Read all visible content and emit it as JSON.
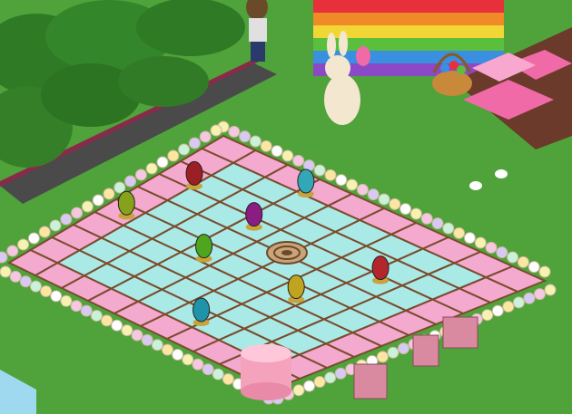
{
  "scene": {
    "type": "isometric-pixel-room",
    "theme": "easter-garden",
    "floor": {
      "rows": 10,
      "cols": 10,
      "tile_colors": [
        "#a9e9e6",
        "#f4a9cf"
      ],
      "grid_color": "#7a4b2c"
    },
    "eggs": [
      {
        "color": "#33a7b6",
        "label": "teal-egg"
      },
      {
        "color": "#9b1f25",
        "label": "red-egg"
      },
      {
        "color": "#8b1d82",
        "label": "purple-egg"
      },
      {
        "color": "#86a11a",
        "label": "green-egg"
      },
      {
        "color": "#4ea61e",
        "label": "lime-egg"
      },
      {
        "color": "#c0a31f",
        "label": "yellow-egg"
      },
      {
        "color": "#b3262b",
        "label": "red-egg-2"
      },
      {
        "color": "#1f93a7",
        "label": "blue-egg"
      }
    ],
    "colors": {
      "grass": "#4fa33a",
      "grass_dark": "#3e8a2d",
      "path": "#4a4a4a",
      "rainbow": [
        "#e8303a",
        "#f08a26",
        "#f2d636",
        "#5bbf3d",
        "#3a8fe0",
        "#8b48c7"
      ],
      "cake": "#f5a3bd",
      "rug": "#c9a47a",
      "bunny": "#f3e7cf"
    },
    "objects": [
      "bunny-statue",
      "egg-basket",
      "rainbow-block",
      "arrow-tiles",
      "player-avatar",
      "cake-pedestal",
      "stone-crates",
      "rug-target",
      "small-bunnies",
      "hedge-bushes"
    ]
  }
}
